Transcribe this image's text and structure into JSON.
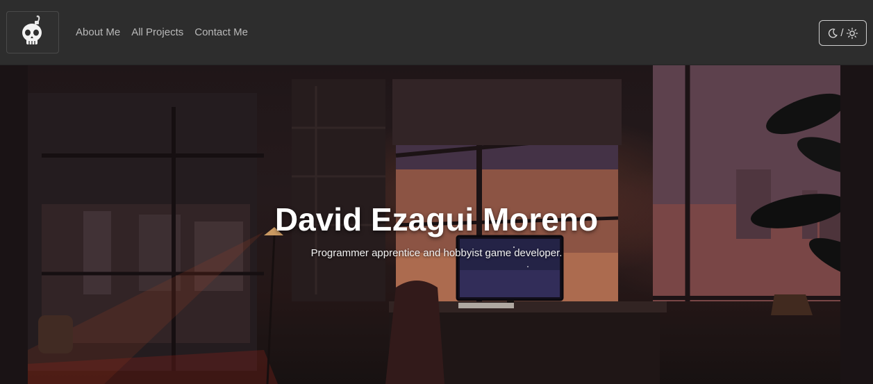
{
  "navbar": {
    "logo_icon": "skull-bomb-icon",
    "links": [
      {
        "label": "About Me"
      },
      {
        "label": "All Projects"
      },
      {
        "label": "Contact Me"
      }
    ],
    "theme_toggle": {
      "moon_icon": "moon-icon",
      "separator": "/",
      "sun_icon": "sun-icon"
    }
  },
  "hero": {
    "title": "David Ezagui Moreno",
    "subtitle": "Programmer apprentice and hobbyist game developer.",
    "background": "lofi-room-sunset-illustration"
  },
  "colors": {
    "navbar_bg": "#2d2d2d",
    "nav_text": "#b9b9b9",
    "hero_text": "#ffffff"
  }
}
